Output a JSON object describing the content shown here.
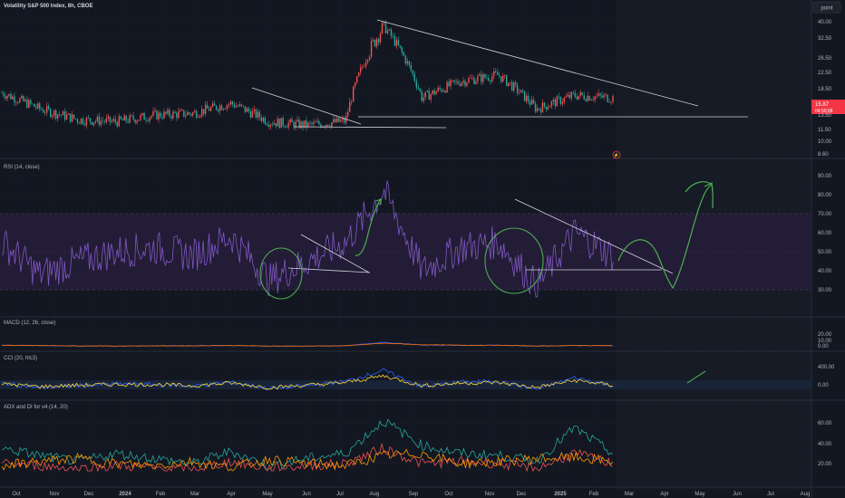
{
  "chart_data": [
    {
      "type": "line",
      "title": "Volatility S&P 500 Index, 8h, CBOE",
      "scale": "log",
      "ylim": [
        8.6,
        40
      ],
      "y_ticks": [
        "40.00",
        "32.50",
        "26.50",
        "22.50",
        "18.50",
        "15.87",
        "13.50",
        "11.50",
        "10.00",
        "8.60"
      ],
      "price_label": "15.87",
      "countdown_label": "04:50:08",
      "series": [
        {
          "name": "",
          "color": "#26a69a",
          "x": [
            "Oct",
            "Nov",
            "Dec",
            "2024",
            "Feb",
            "Mar",
            "Apr",
            "May",
            "Jun",
            "Jul",
            "Aug",
            "Sep",
            "Oct",
            "Nov",
            "Dec",
            "2025",
            "Feb"
          ],
          "values": [
            17.5,
            14.5,
            12.8,
            12.5,
            13.5,
            13.8,
            15.5,
            12.5,
            12.0,
            12.6,
            38.0,
            16.5,
            20.0,
            21.5,
            14.5,
            17.0,
            16.5
          ]
        }
      ],
      "drawings": [
        {
          "name": "resistance-downtrend",
          "from": [
            "Aug",
            40.0
          ],
          "to": [
            "Apr",
            17.0
          ]
        },
        {
          "name": "support-horizontal",
          "from": [
            "Jul",
            13.5
          ],
          "to": [
            "Jun",
            13.5
          ]
        },
        {
          "name": "wedge-upper",
          "from": [
            "Apr",
            19.0
          ],
          "to": [
            "Jul",
            12.5
          ]
        },
        {
          "name": "wedge-lower",
          "from": [
            "May",
            12.0
          ],
          "to": [
            "Aug",
            12.0
          ]
        }
      ],
      "badge": "point"
    },
    {
      "type": "line",
      "title": "RSI (14, close)",
      "ylim": [
        30,
        90
      ],
      "y_ticks": [
        "90.00",
        "80.00",
        "70.00",
        "60.00",
        "50.00",
        "40.00",
        "30.00"
      ],
      "band": [
        30,
        70
      ],
      "series": [
        {
          "name": "",
          "color": "#7e57c2",
          "x": [
            "Oct",
            "Nov",
            "Dec",
            "2024",
            "Feb",
            "Mar",
            "Apr",
            "May",
            "Jun",
            "Jul",
            "Aug",
            "Sep",
            "Oct",
            "Nov",
            "Dec",
            "2025",
            "Feb"
          ],
          "values": [
            55,
            38,
            45,
            50,
            52,
            48,
            58,
            35,
            45,
            55,
            82,
            40,
            52,
            55,
            32,
            60,
            48
          ]
        }
      ]
    },
    {
      "type": "line",
      "title": "MACD (12, 26, close)",
      "y_ticks": [
        "20.00",
        "10.00",
        "0.00"
      ],
      "series": [
        {
          "name": "",
          "color": "#2962ff",
          "values": [
            1.2,
            0.5,
            -0.2,
            -0.3,
            0.1,
            0.2,
            0.8,
            -0.5,
            -0.3,
            0.2,
            6.0,
            1.5,
            1.0,
            1.2,
            -0.4,
            0.8,
            0.2
          ]
        },
        {
          "name": "",
          "color": "#ff6d00",
          "values": [
            1.0,
            0.7,
            0.0,
            -0.2,
            0.0,
            0.1,
            0.6,
            -0.3,
            -0.3,
            0.1,
            4.5,
            2.0,
            1.2,
            1.0,
            -0.2,
            0.6,
            0.3
          ]
        }
      ]
    },
    {
      "type": "line",
      "title": "CCI (20, hlc3)",
      "y_ticks": [
        "400.00",
        "0.00"
      ],
      "series": [
        {
          "name": "",
          "color": "#2962ff",
          "values": [
            40,
            -60,
            -20,
            20,
            10,
            -30,
            60,
            -80,
            -20,
            80,
            320,
            -40,
            60,
            80,
            -100,
            160,
            -20
          ]
        },
        {
          "name": "",
          "color": "#fdd835",
          "values": [
            20,
            -40,
            -10,
            10,
            5,
            -20,
            40,
            -60,
            -10,
            50,
            200,
            -20,
            40,
            50,
            -60,
            100,
            -10
          ]
        }
      ]
    },
    {
      "type": "line",
      "title": "ADX and DI for v4 (14, 20)",
      "y_ticks": [
        "60.00",
        "40.00",
        "20.00"
      ],
      "series": [
        {
          "name": "",
          "color": "#26a69a",
          "values": [
            35,
            28,
            22,
            30,
            25,
            20,
            32,
            18,
            25,
            30,
            62,
            38,
            30,
            28,
            22,
            55,
            30
          ]
        },
        {
          "name": "",
          "color": "#ef5350",
          "values": [
            20,
            18,
            15,
            18,
            16,
            14,
            22,
            15,
            18,
            20,
            35,
            20,
            22,
            20,
            15,
            30,
            20
          ]
        },
        {
          "name": "",
          "color": "#ff9800",
          "values": [
            18,
            22,
            25,
            20,
            18,
            22,
            16,
            24,
            20,
            18,
            28,
            30,
            20,
            22,
            25,
            26,
            22
          ]
        }
      ]
    }
  ],
  "x_axis_labels": [
    "Oct",
    "Nov",
    "Dec",
    "2024",
    "Feb",
    "Mar",
    "Apr",
    "May",
    "Jun",
    "Jul",
    "Aug",
    "Sep",
    "Oct",
    "Nov",
    "Dec",
    "2025",
    "Feb",
    "Mar",
    "Apr",
    "May",
    "Jun",
    "Jul",
    "Aug"
  ],
  "colors": {
    "background": "#131722",
    "grid": "#1e222d",
    "up": "#26a69a",
    "down": "#ef5350",
    "rsi_line": "#7e57c2",
    "rsi_band": "#2a2040",
    "drawing": "#d1d4dc",
    "annotation": "#4caf50",
    "price_badge": "#f23645"
  }
}
